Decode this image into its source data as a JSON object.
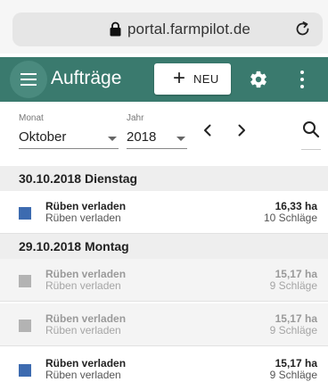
{
  "browser": {
    "url": "portal.farmpilot.de"
  },
  "app_bar": {
    "title": "Aufträge",
    "new_button_label": "NEU",
    "new_button_icon": "+",
    "background_color": "#3a7a6e"
  },
  "filters": {
    "month_label": "Monat",
    "month_value": "Oktober",
    "year_label": "Jahr",
    "year_value": "2018",
    "prev_icon": "chevron-left-icon",
    "next_icon": "chevron-right-icon",
    "prev_glyph": "‹",
    "next_glyph": "›"
  },
  "groups": [
    {
      "date": "30.10.2018 Dienstag",
      "items": [
        {
          "title": "Rüben verladen",
          "subtitle": "Rüben verladen",
          "area": "16,33 ha",
          "fields": "10 Schläge",
          "color": "#3d6bb0",
          "disabled": false
        }
      ]
    },
    {
      "date": "29.10.2018 Montag",
      "items": [
        {
          "title": "Rüben verladen",
          "subtitle": "Rüben verladen",
          "area": "15,17 ha",
          "fields": "9 Schläge",
          "color": "#b3b3b3",
          "disabled": true
        },
        {
          "title": "Rüben verladen",
          "subtitle": "Rüben verladen",
          "area": "15,17 ha",
          "fields": "9 Schläge",
          "color": "#b3b3b3",
          "disabled": true
        },
        {
          "title": "Rüben verladen",
          "subtitle": "Rüben verladen",
          "area": "15,17 ha",
          "fields": "9 Schläge",
          "color": "#3d6bb0",
          "disabled": false
        }
      ]
    }
  ]
}
